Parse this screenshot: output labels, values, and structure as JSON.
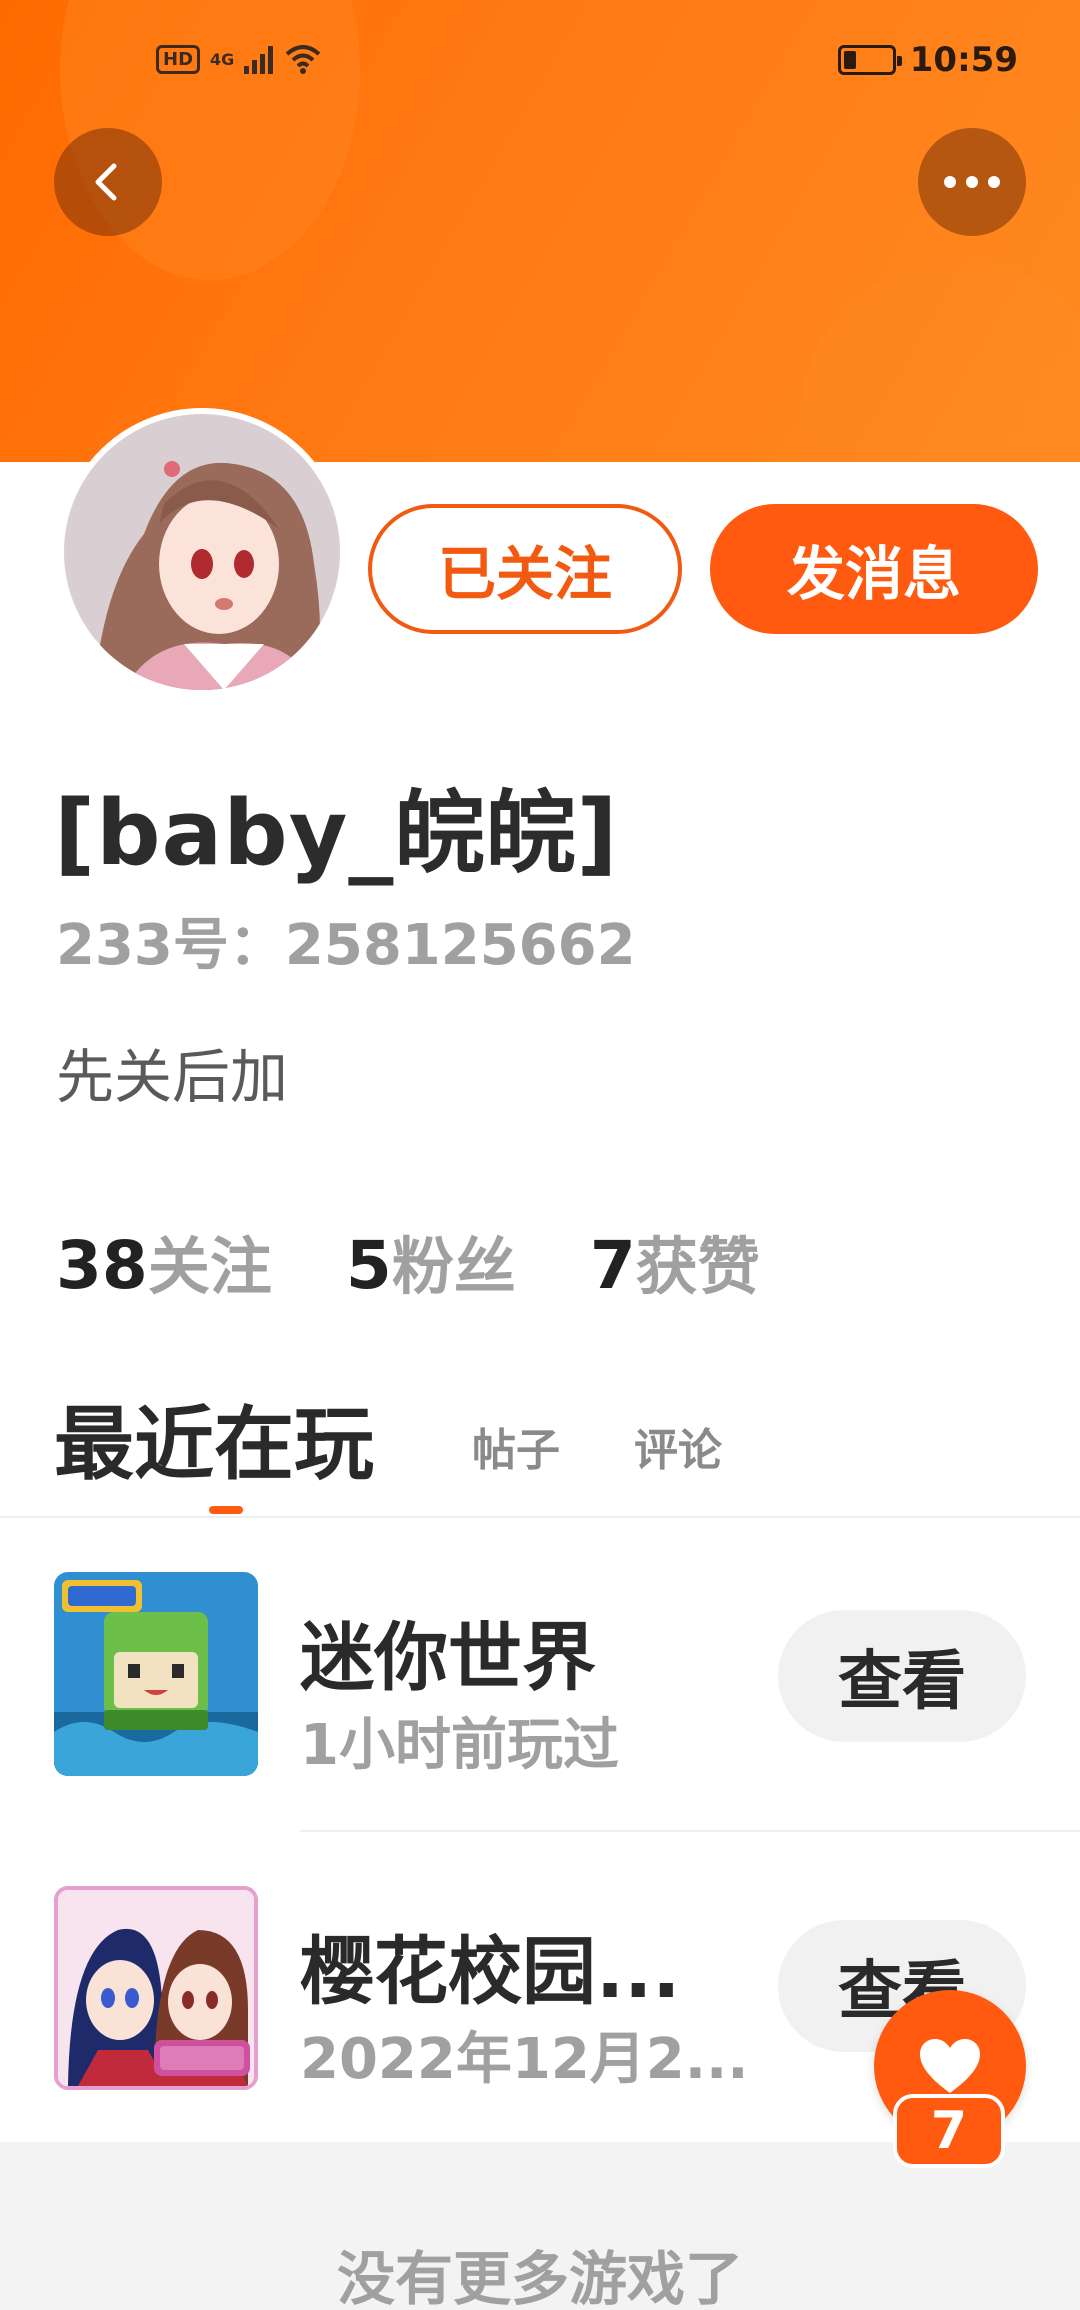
{
  "status_bar": {
    "hd_label": "HD",
    "network_label": "4G",
    "time": "10:59"
  },
  "header": {
    "back_icon": "chevron-left-icon",
    "more_icon": "more-horizontal-icon"
  },
  "profile": {
    "follow_label": "已关注",
    "message_label": "发消息",
    "username": "[baby_皖皖]",
    "user_id": "233号：258125662",
    "bio": "先关后加",
    "stats": [
      {
        "value": "38",
        "label": "关注"
      },
      {
        "value": "5",
        "label": "粉丝"
      },
      {
        "value": "7",
        "label": "获赞"
      }
    ]
  },
  "tabs": {
    "active": "最近在玩",
    "posts": "帖子",
    "comments": "评论"
  },
  "games": [
    {
      "name": "迷你世界",
      "subtitle": "1小时前玩过",
      "button": "查看"
    },
    {
      "name": "樱花校园...",
      "subtitle": "2022年12月2...",
      "button": "查看"
    }
  ],
  "footer": {
    "no_more_text": "没有更多游戏了"
  },
  "like_fab": {
    "count": "7",
    "icon": "heart-icon"
  },
  "colors": {
    "accent": "#ff5a10",
    "header_bg": "#ff7a14",
    "muted_text": "#a0a0a0"
  }
}
